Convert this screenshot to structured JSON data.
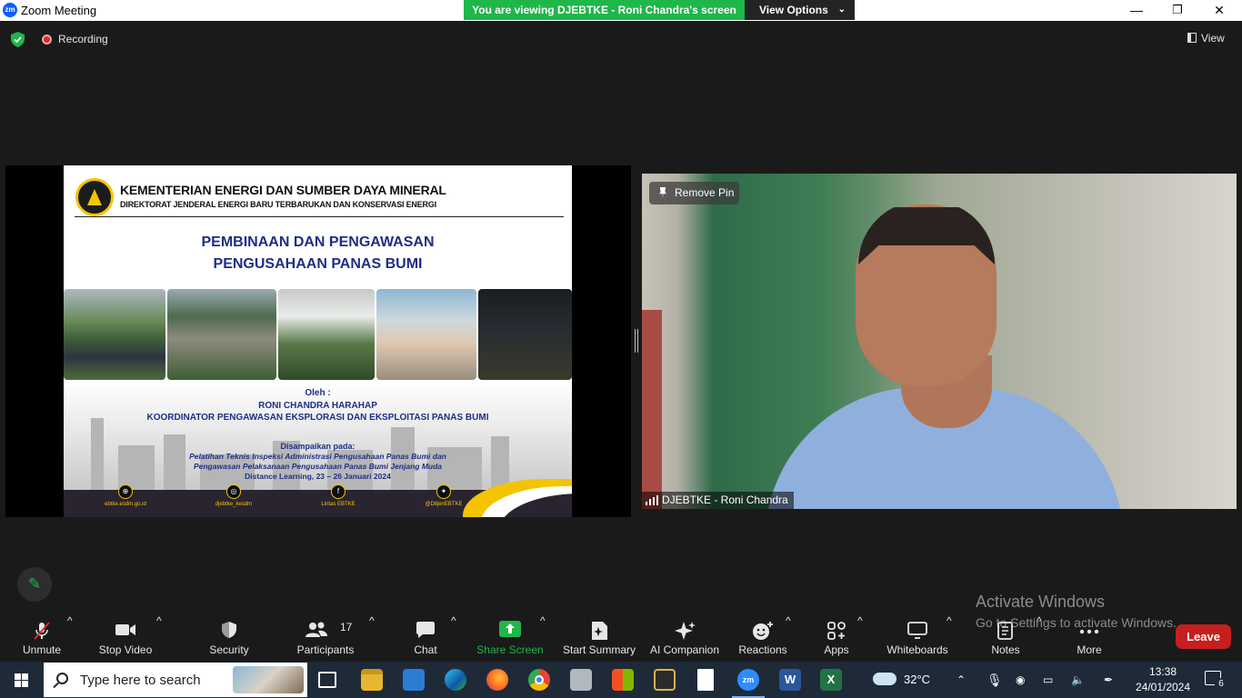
{
  "window": {
    "title": "Zoom Meeting",
    "app_icon_text": "zm",
    "minimize": "—",
    "maximize": "❐",
    "close": "✕"
  },
  "banner": {
    "viewing": "You are viewing DJEBTKE - Roni Chandra's screen",
    "view_options": "View Options",
    "chevron": "⌄"
  },
  "status": {
    "recording": "Recording",
    "view": "View"
  },
  "slide": {
    "ministry": "KEMENTERIAN ENERGI DAN SUMBER DAYA MINERAL",
    "directorate": "DIREKTORAT JENDERAL ENERGI BARU TERBARUKAN DAN KONSERVASI ENERGI",
    "title_line1": "PEMBINAAN DAN PENGAWASAN",
    "title_line2": "PENGUSAHAAN PANAS BUMI",
    "by": "Oleh :",
    "presenter": "RONI CHANDRA HARAHAP",
    "position": "KOORDINATOR PENGAWASAN EKSPLORASI DAN EKSPLOITASI PANAS BUMI",
    "delivered": "Disampaikan pada:",
    "training_line1": "Pelatihan Teknis Inspeksi Administrasi Pengusahaan Panas Bumi dan",
    "training_line2": "Pengawasan Pelaksanaan Pengusahaan Panas Bumi Jenjang Muda",
    "training_line3": "Distance Learning, 23 – 26 Januari 2024",
    "socials": [
      {
        "icon": "globe-icon",
        "glyph": "⊕",
        "text": "ebtke.esdm.go.id"
      },
      {
        "icon": "instagram-icon",
        "glyph": "◎",
        "text": "djebtke_kesdm"
      },
      {
        "icon": "facebook-icon",
        "glyph": "f",
        "text": "Lintas EBTKE"
      },
      {
        "icon": "twitter-icon",
        "glyph": "✦",
        "text": "@DitjenEBTKE"
      }
    ]
  },
  "video": {
    "remove_pin": "Remove Pin",
    "participant_name": "DJEBTKE - Roni Chandra"
  },
  "toolbar": {
    "unmute": "Unmute",
    "stop_video": "Stop Video",
    "security": "Security",
    "participants": "Participants",
    "participants_count": "17",
    "chat": "Chat",
    "share_screen": "Share Screen",
    "start_summary": "Start Summary",
    "ai_companion": "AI Companion",
    "reactions": "Reactions",
    "apps": "Apps",
    "whiteboards": "Whiteboards",
    "notes": "Notes",
    "more": "More",
    "leave": "Leave",
    "caret": "^"
  },
  "watermark": {
    "line1": "Activate Windows",
    "line2": "Go to Settings to activate Windows."
  },
  "taskbar": {
    "search_placeholder": "Type here to search",
    "temperature": "32°C",
    "time": "13:38",
    "date": "24/01/2024",
    "notification_count": "6",
    "zoom_label": "zm",
    "word_label": "W",
    "excel_label": "X"
  },
  "colors": {
    "green": "#1fb64a",
    "leave_red": "#c5201f",
    "slide_blue": "#1e2e86",
    "taskbar": "#1f2a38"
  }
}
